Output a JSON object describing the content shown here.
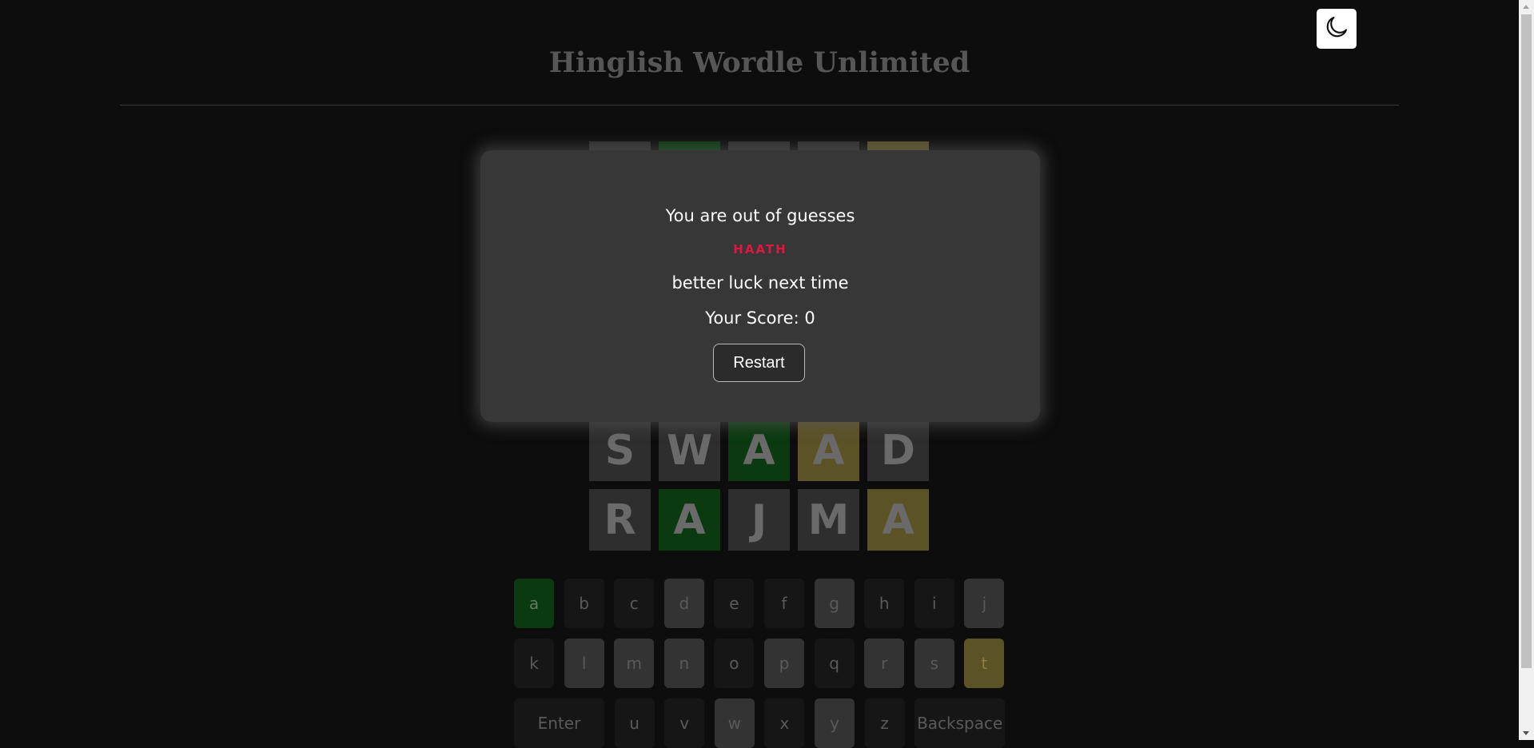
{
  "header": {
    "title": "Hinglish Wordle Unlimited",
    "theme_toggle_icon": "moon-icon"
  },
  "colors": {
    "background": "#0d0d0d",
    "tile_absent": "#2e2e2e",
    "tile_correct": "#0b3a10",
    "tile_present": "#5b5326",
    "answer_text": "#e0173f",
    "modal_bg": "#373737"
  },
  "board": {
    "rows": [
      [
        {
          "letter": "",
          "state": "absent"
        },
        {
          "letter": "",
          "state": "correct"
        },
        {
          "letter": "",
          "state": "absent"
        },
        {
          "letter": "",
          "state": "absent"
        },
        {
          "letter": "",
          "state": "present"
        }
      ],
      [
        {
          "letter": "S",
          "state": "absent"
        },
        {
          "letter": "W",
          "state": "absent"
        },
        {
          "letter": "A",
          "state": "correct"
        },
        {
          "letter": "A",
          "state": "present"
        },
        {
          "letter": "D",
          "state": "absent"
        }
      ],
      [
        {
          "letter": "R",
          "state": "absent"
        },
        {
          "letter": "A",
          "state": "correct"
        },
        {
          "letter": "J",
          "state": "absent"
        },
        {
          "letter": "M",
          "state": "absent"
        },
        {
          "letter": "A",
          "state": "present"
        }
      ]
    ]
  },
  "keyboard": {
    "rows": [
      [
        {
          "label": "a",
          "state": "correct"
        },
        {
          "label": "b",
          "state": "unused"
        },
        {
          "label": "c",
          "state": "unused"
        },
        {
          "label": "d",
          "state": "absent"
        },
        {
          "label": "e",
          "state": "unused"
        },
        {
          "label": "f",
          "state": "unused"
        },
        {
          "label": "g",
          "state": "absent"
        },
        {
          "label": "h",
          "state": "unused"
        },
        {
          "label": "i",
          "state": "unused"
        },
        {
          "label": "j",
          "state": "absent"
        }
      ],
      [
        {
          "label": "k",
          "state": "unused"
        },
        {
          "label": "l",
          "state": "absent"
        },
        {
          "label": "m",
          "state": "absent"
        },
        {
          "label": "n",
          "state": "absent"
        },
        {
          "label": "o",
          "state": "unused"
        },
        {
          "label": "p",
          "state": "absent"
        },
        {
          "label": "q",
          "state": "unused"
        },
        {
          "label": "r",
          "state": "absent"
        },
        {
          "label": "s",
          "state": "absent"
        },
        {
          "label": "t",
          "state": "present"
        }
      ],
      [
        {
          "label": "Enter",
          "state": "unused"
        },
        {
          "label": "u",
          "state": "unused"
        },
        {
          "label": "v",
          "state": "unused"
        },
        {
          "label": "w",
          "state": "absent"
        },
        {
          "label": "x",
          "state": "unused"
        },
        {
          "label": "y",
          "state": "absent"
        },
        {
          "label": "z",
          "state": "unused"
        },
        {
          "label": "Backspace",
          "state": "unused"
        }
      ]
    ]
  },
  "modal": {
    "message": "You are out of guesses",
    "answer": "HAATH",
    "subtext": "better luck next time",
    "score_text": "Your Score: 0",
    "restart_label": "Restart"
  }
}
